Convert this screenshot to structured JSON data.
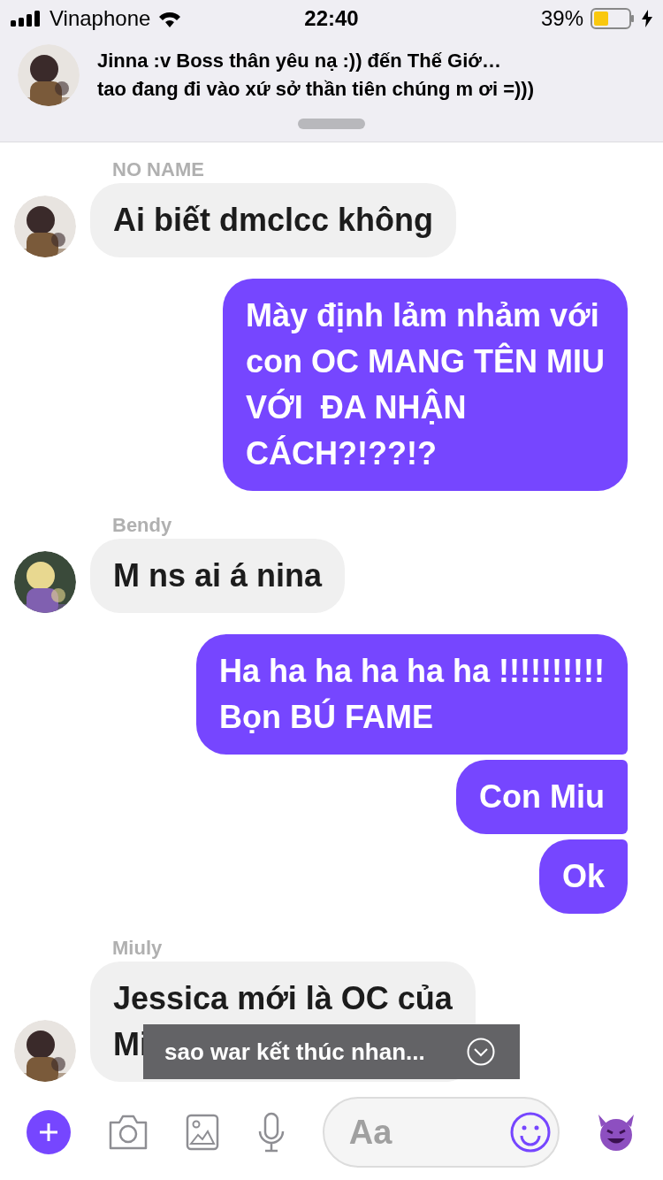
{
  "status_bar": {
    "carrier": "Vinaphone",
    "time": "22:40",
    "battery": "39%"
  },
  "notification": {
    "title": "Jinna :v Boss thân yêu nạ :)) đến Thế Giớ…",
    "body": "tao đang đi vào xứ sở thần tiên chúng m ơi =)))"
  },
  "messages": [
    {
      "kind": "received",
      "sender": "NO NAME",
      "lines": [
        "Ai biết dmclcc không"
      ]
    },
    {
      "kind": "sent",
      "lines": [
        "Mày định lảm nhảm với",
        "con OC MANG TÊN MIU",
        "VỚI  ĐA NHẬN",
        "CÁCH?!??!?"
      ]
    },
    {
      "kind": "received",
      "sender": "Bendy",
      "lines": [
        "M ns ai á nina"
      ]
    },
    {
      "kind": "sent",
      "lines": [
        "Ha ha ha ha ha ha !!!!!!!!!!",
        "Bọn BÚ FAME"
      ]
    },
    {
      "kind": "sent",
      "lines": [
        "Con Miu"
      ]
    },
    {
      "kind": "sent",
      "lines": [
        "Ok"
      ]
    },
    {
      "kind": "received",
      "sender": "Miuly",
      "lines": [
        "Jessica mới là OC của",
        "Mi"
      ]
    }
  ],
  "toast": {
    "text": "sao war kết thúc nhan..."
  },
  "composer": {
    "placeholder": "Aa"
  }
}
